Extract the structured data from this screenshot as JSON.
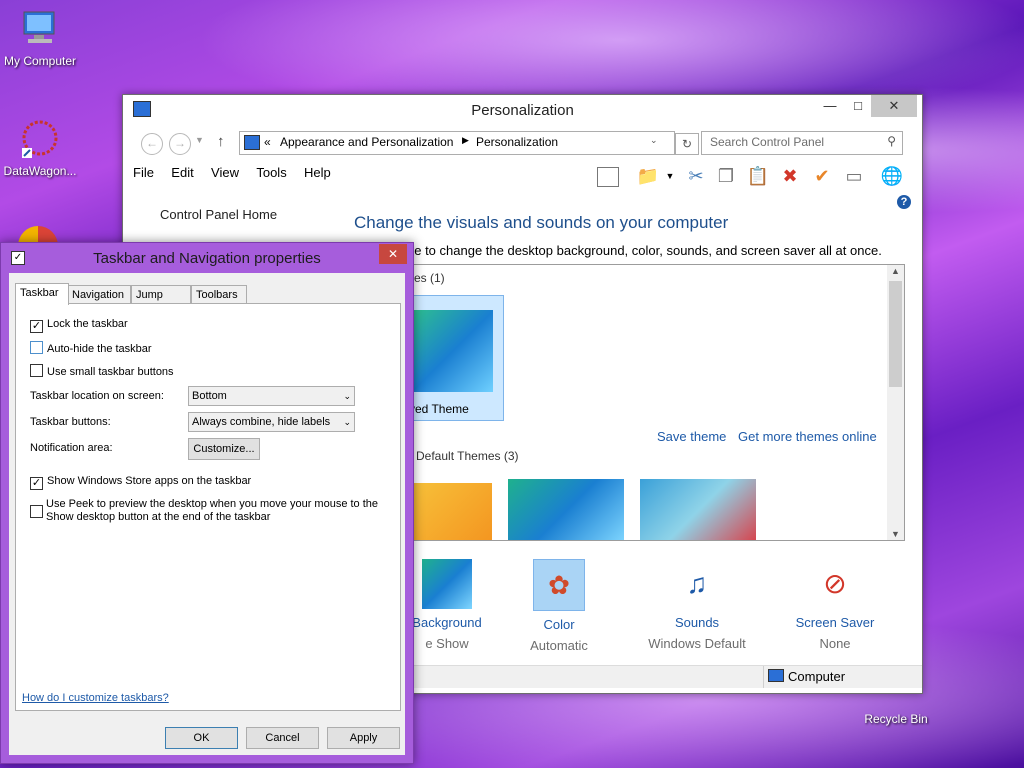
{
  "desktop": {
    "icons": [
      {
        "label": "My Computer"
      },
      {
        "label": "DataWagon..."
      },
      {
        "label": "Recycle Bin"
      }
    ]
  },
  "personalization_window": {
    "title": "Personalization",
    "address": {
      "path_prefix": "«",
      "crumb1": "Appearance and Personalization",
      "crumb2": "Personalization",
      "search_placeholder": "Search Control Panel"
    },
    "menu": [
      "File",
      "Edit",
      "View",
      "Tools",
      "Help"
    ],
    "left_link": "Control Panel Home",
    "heading": "Change the visuals and sounds on your computer",
    "subheading": "ne to change the desktop background, color, sounds, and screen saver all at once.",
    "my_themes_label": "es (1)",
    "unsaved_theme_label": "ved Theme",
    "save_theme": "Save theme",
    "get_more_themes": "Get more themes online",
    "default_themes_label": "Default Themes (3)",
    "bottom_items": [
      {
        "label": "Background",
        "sub": "e Show"
      },
      {
        "label": "Color",
        "sub": "Automatic"
      },
      {
        "label": "Sounds",
        "sub": "Windows Default"
      },
      {
        "label": "Screen Saver",
        "sub": "None"
      }
    ],
    "status": "Computer"
  },
  "taskbar_dialog": {
    "title": "Taskbar and Navigation properties",
    "tabs": [
      "Taskbar",
      "Navigation",
      "Jump Lists",
      "Toolbars"
    ],
    "options": {
      "lock": "Lock the taskbar",
      "autohide": "Auto-hide the taskbar",
      "small": "Use small taskbar buttons",
      "store": "Show Windows Store apps on the taskbar",
      "peek_line1": "Use Peek to preview the desktop when you move your mouse to the",
      "peek_line2": "Show desktop button at the end of the taskbar"
    },
    "checked": {
      "lock": true,
      "autohide": false,
      "small": false,
      "store": true,
      "peek": false
    },
    "location_label": "Taskbar location on screen:",
    "location_value": "Bottom",
    "buttons_label": "Taskbar buttons:",
    "buttons_value": "Always combine, hide labels",
    "notification_label": "Notification area:",
    "customize_button": "Customize...",
    "help_link": "How do I customize taskbars?",
    "ok": "OK",
    "cancel": "Cancel",
    "apply": "Apply"
  }
}
